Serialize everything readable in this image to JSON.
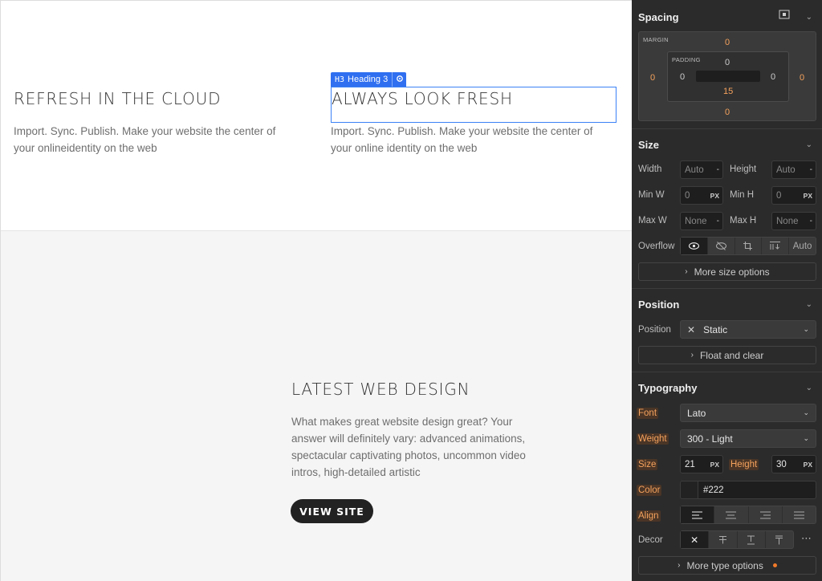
{
  "canvas": {
    "section1": {
      "left": {
        "heading": "REFRESH IN THE CLOUD",
        "paragraph": "Import. Sync. Publish. Make your website the center of your onlineidentity on the web"
      },
      "right": {
        "heading": "ALWAYS LOOK FRESH",
        "paragraph": "Import. Sync. Publish. Make your website the center of your online identity on the web"
      },
      "selection_tag": {
        "icon_text": "H3",
        "label": "Heading 3"
      }
    },
    "section2": {
      "heading": "LATEST WEB DESIGN",
      "paragraph": "What makes great website design great?  Your answer will definitely vary: advanced animations, spectacular captivating photos, uncommon video intros, high-detailed artistic",
      "button": "VIEW SITE"
    }
  },
  "panel": {
    "spacing": {
      "title": "Spacing",
      "margin_label": "MARGIN",
      "padding_label": "PADDING",
      "margin": {
        "top": "0",
        "right": "0",
        "bottom": "0",
        "left": "0"
      },
      "padding": {
        "top": "0",
        "right": "0",
        "bottom": "15",
        "left": "0"
      }
    },
    "size": {
      "title": "Size",
      "width_label": "Width",
      "width": "Auto",
      "height_label": "Height",
      "height": "Auto",
      "minw_label": "Min W",
      "minw": "0",
      "minw_unit": "PX",
      "minh_label": "Min H",
      "minh": "0",
      "minh_unit": "PX",
      "maxw_label": "Max W",
      "maxw": "None",
      "maxh_label": "Max H",
      "maxh": "None",
      "overflow_label": "Overflow",
      "overflow_auto": "Auto",
      "more": "More size options"
    },
    "position": {
      "title": "Position",
      "label": "Position",
      "value": "Static",
      "float": "Float and clear"
    },
    "typography": {
      "title": "Typography",
      "font_label": "Font",
      "font": "Lato",
      "weight_label": "Weight",
      "weight": "300 - Light",
      "size_label": "Size",
      "size": "21",
      "size_unit": "PX",
      "height_label": "Height",
      "height": "30",
      "height_unit": "PX",
      "color_label": "Color",
      "color": "#222",
      "align_label": "Align",
      "decor_label": "Decor",
      "more": "More type options"
    }
  }
}
